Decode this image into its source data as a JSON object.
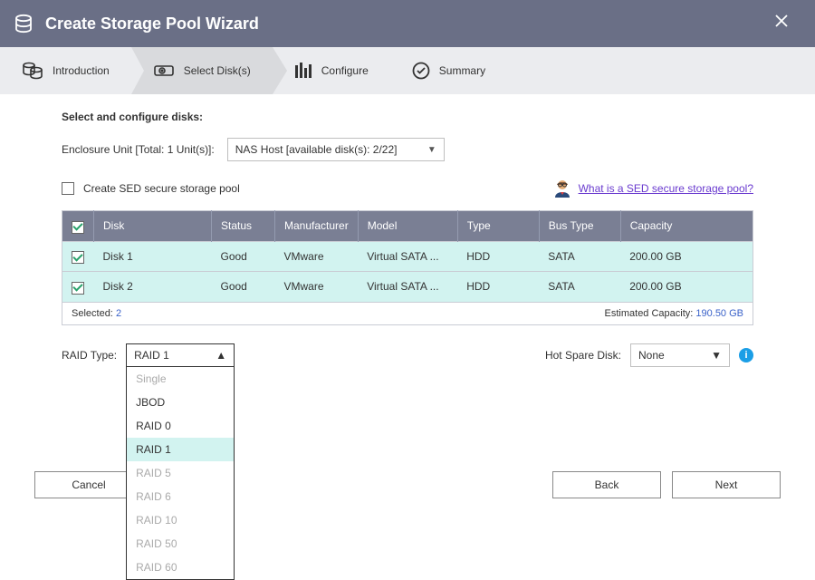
{
  "title": "Create Storage Pool Wizard",
  "steps": {
    "introduction": "Introduction",
    "select_disks": "Select Disk(s)",
    "configure": "Configure",
    "summary": "Summary"
  },
  "prompt": "Select and configure disks:",
  "enclosure": {
    "label": "Enclosure Unit [Total: 1 Unit(s)]:",
    "value": "NAS Host [available disk(s): 2/22]"
  },
  "sed": {
    "checkbox_label": "Create SED secure storage pool",
    "help_link": "What is a SED secure storage pool?"
  },
  "table": {
    "headers": {
      "disk": "Disk",
      "status": "Status",
      "manufacturer": "Manufacturer",
      "model": "Model",
      "type": "Type",
      "bus_type": "Bus Type",
      "capacity": "Capacity"
    },
    "rows": [
      {
        "disk": "Disk 1",
        "status": "Good",
        "manufacturer": "VMware",
        "model": "Virtual SATA ...",
        "type": "HDD",
        "bus_type": "SATA",
        "capacity": "200.00 GB"
      },
      {
        "disk": "Disk 2",
        "status": "Good",
        "manufacturer": "VMware",
        "model": "Virtual SATA ...",
        "type": "HDD",
        "bus_type": "SATA",
        "capacity": "200.00 GB"
      }
    ],
    "footer": {
      "selected_label": "Selected:",
      "selected_count": "2",
      "estimated_label": "Estimated Capacity:",
      "estimated_value": "190.50 GB"
    }
  },
  "raid": {
    "label": "RAID Type:",
    "value": "RAID 1",
    "options": [
      {
        "label": "Single",
        "disabled": true
      },
      {
        "label": "JBOD",
        "disabled": false
      },
      {
        "label": "RAID 0",
        "disabled": false
      },
      {
        "label": "RAID 1",
        "disabled": false,
        "highlight": true
      },
      {
        "label": "RAID 5",
        "disabled": true
      },
      {
        "label": "RAID 6",
        "disabled": true
      },
      {
        "label": "RAID 10",
        "disabled": true
      },
      {
        "label": "RAID 50",
        "disabled": true
      },
      {
        "label": "RAID 60",
        "disabled": true
      }
    ]
  },
  "hotspare": {
    "label": "Hot Spare Disk:",
    "value": "None"
  },
  "buttons": {
    "cancel": "Cancel",
    "back": "Back",
    "next": "Next"
  }
}
